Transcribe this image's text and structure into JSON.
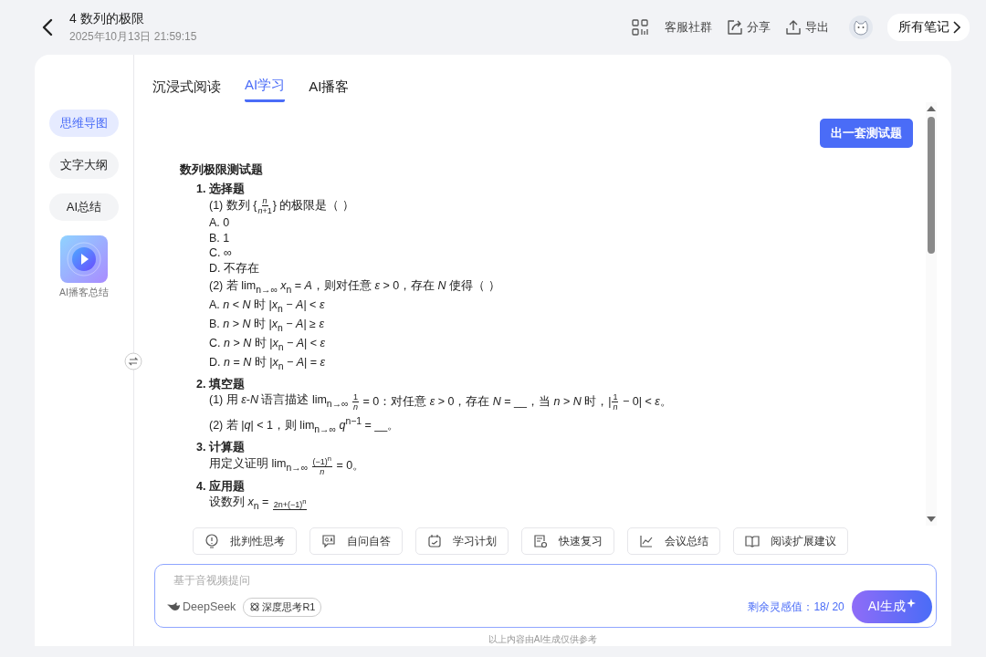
{
  "header": {
    "title": "4 数列的极限",
    "datetime": "2025年10月13日 21:59:15",
    "actions": [
      {
        "kind": "grid",
        "label": "客服社群"
      },
      {
        "kind": "share",
        "label": "分享"
      },
      {
        "kind": "export",
        "label": "导出"
      }
    ],
    "notes_button": "所有笔记"
  },
  "sidebar": {
    "items": [
      {
        "label": "思维导图",
        "selected": true
      },
      {
        "label": "文字大纲",
        "selected": false
      },
      {
        "label": "AI总结",
        "selected": false
      }
    ],
    "podcast": {
      "label": "AI播客总结"
    }
  },
  "tabs": [
    {
      "label": "沉浸式阅读",
      "selected": false
    },
    {
      "label": "AI学习",
      "selected": true
    },
    {
      "label": "AI播客",
      "selected": false
    }
  ],
  "generate_button": "出一套测试题",
  "quiz": {
    "title": "数列极限测试题",
    "sections": [
      {
        "heading": "1. 选择题",
        "questions": [
          {
            "lines": [
              [
                {
                  "kind": "text",
                  "text": "(1) 数列 {"
                },
                {
                  "kind": "frac",
                  "num": "*n*",
                  "den": "*n*+1"
                },
                {
                  "kind": "text",
                  "text": "} 的极限是（ ）"
                }
              ],
              [
                {
                  "kind": "text",
                  "text": "A. 0"
                }
              ],
              [
                {
                  "kind": "text",
                  "text": "B. 1"
                }
              ],
              [
                {
                  "kind": "text",
                  "text": "C. ∞"
                }
              ],
              [
                {
                  "kind": "text",
                  "text": "D. 不存在"
                }
              ]
            ]
          },
          {
            "lines": [
              [
                {
                  "kind": "text",
                  "text": "(2) 若 lim$_{n→∞}$ *x*$_{n}$ = *A*，则对任意 *ε* > 0，存在 *N* 使得（ ）"
                }
              ],
              [
                {
                  "kind": "text",
                  "text": "A. *n* < *N* 时 |*x*$_{n}$ − *A*| < *ε*"
                }
              ],
              [
                {
                  "kind": "text",
                  "text": "B. *n* > *N* 时 |*x*$_{n}$ − *A*| ≥ *ε*"
                }
              ],
              [
                {
                  "kind": "text",
                  "text": "C. *n* > *N* 时 |*x*$_{n}$ − *A*| < *ε*"
                }
              ],
              [
                {
                  "kind": "text",
                  "text": "D. *n* = *N* 时 |*x*$_{n}$ − *A*| = *ε*"
                }
              ]
            ]
          }
        ]
      },
      {
        "heading": "2. 填空题",
        "questions": [
          {
            "lines": [
              [
                {
                  "kind": "text",
                  "text": "(1) 用 *ε*-*N* 语言描述 lim$_{n→∞}$ "
                },
                {
                  "kind": "frac",
                  "num": "1",
                  "den": "*n*"
                },
                {
                  "kind": "text",
                  "text": " = 0：对任意 *ε* > 0，存在 *N* = __，当 *n* > *N* 时，|"
                },
                {
                  "kind": "frac",
                  "num": "1",
                  "den": "*n*"
                },
                {
                  "kind": "text",
                  "text": " − 0| < *ε*。"
                }
              ]
            ]
          },
          {
            "lines": [
              [
                {
                  "kind": "text",
                  "text": "(2) 若 |*q*| < 1，则 lim$_{n→∞}$ *q*$^{n−1}$ = __。"
                }
              ]
            ]
          }
        ]
      },
      {
        "heading": "3. 计算题",
        "questions": [
          {
            "lines": [
              [
                {
                  "kind": "text",
                  "text": "用定义证明 lim$_{n→∞}$ "
                },
                {
                  "kind": "frac",
                  "num": "(−1)$^{n}$",
                  "den": "*n*"
                },
                {
                  "kind": "text",
                  "text": " = 0。"
                }
              ]
            ]
          }
        ]
      },
      {
        "heading": "4. 应用题",
        "questions": [
          {
            "lines": [
              [
                {
                  "kind": "text",
                  "text": "设数列 *x*$_{n}$ = "
                },
                {
                  "kind": "frac",
                  "num": "2n+(−1)$^{n}$"
                }
              ]
            ]
          }
        ]
      }
    ]
  },
  "shortcuts": [
    {
      "kind": "bulb",
      "label": "批判性思考"
    },
    {
      "kind": "qa",
      "label": "自问自答"
    },
    {
      "kind": "plan",
      "label": "学习计划"
    },
    {
      "kind": "review",
      "label": "快速复习"
    },
    {
      "kind": "chart",
      "label": "会议总结"
    },
    {
      "kind": "book",
      "label": "阅读扩展建议"
    }
  ],
  "composer": {
    "placeholder": "基于音视频提问",
    "model": "DeepSeek",
    "mode_chip": "深度思考R1",
    "quota": "剩余灵感值：18/ 20",
    "submit": "AI生成"
  },
  "disclaimer": "以上内容由AI生成仅供参考"
}
